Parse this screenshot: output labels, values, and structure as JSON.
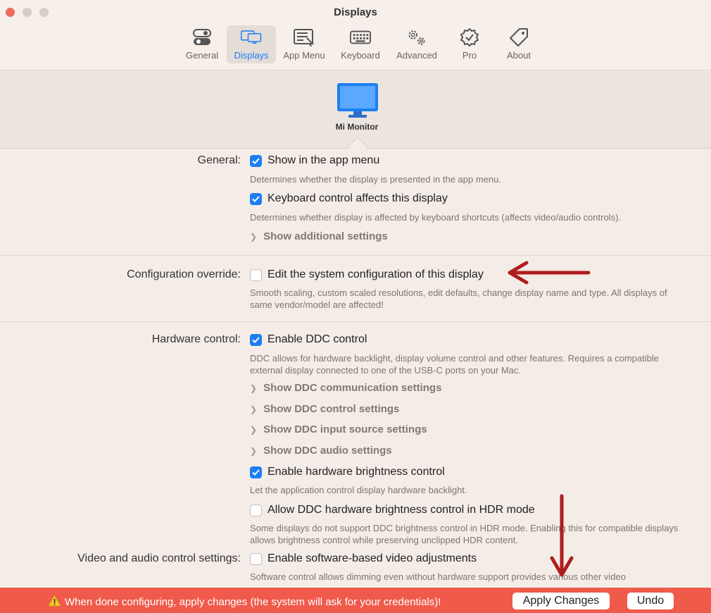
{
  "window": {
    "title": "Displays"
  },
  "tabs": [
    {
      "label": "General",
      "icon": "toggles-icon"
    },
    {
      "label": "Displays",
      "icon": "displays-icon"
    },
    {
      "label": "App Menu",
      "icon": "app-menu-icon"
    },
    {
      "label": "Keyboard",
      "icon": "keyboard-icon"
    },
    {
      "label": "Advanced",
      "icon": "gears-icon"
    },
    {
      "label": "Pro",
      "icon": "verified-badge-icon"
    },
    {
      "label": "About",
      "icon": "tag-icon"
    }
  ],
  "active_tab": "Displays",
  "display": {
    "name": "Mi Monitor"
  },
  "general": {
    "label": "General:",
    "show_in_menu": {
      "label": "Show in the app menu",
      "checked": true,
      "desc": "Determines whether the display is presented in the app menu."
    },
    "keyboard_control": {
      "label": "Keyboard control affects this display",
      "checked": true,
      "desc": "Determines whether display is affected by keyboard shortcuts (affects video/audio controls)."
    },
    "additional": "Show additional settings"
  },
  "config_override": {
    "label": "Configuration override:",
    "edit_config": {
      "label": "Edit the system configuration of this display",
      "checked": false,
      "desc": "Smooth scaling, custom scaled resolutions, edit defaults, change display name and type. All displays of same vendor/model are affected!"
    }
  },
  "hardware": {
    "label": "Hardware control:",
    "ddc": {
      "label": "Enable DDC control",
      "checked": true,
      "desc": "DDC allows for hardware backlight, display volume control and other features. Requires a compatible external display connected to one of the USB-C ports on your Mac."
    },
    "disclosures": [
      "Show DDC communication settings",
      "Show DDC control settings",
      "Show DDC input source settings",
      "Show DDC audio settings"
    ],
    "hw_brightness": {
      "label": "Enable hardware brightness control",
      "checked": true,
      "desc": "Let the application control display hardware backlight."
    },
    "hdr": {
      "label": "Allow DDC hardware brightness control in HDR mode",
      "checked": false,
      "desc": "Some displays do not support DDC brightness control in HDR mode. Enabling this for compatible displays allows brightness control while preserving unclipped HDR content."
    }
  },
  "video_audio": {
    "label": "Video and audio control settings:",
    "software": {
      "label": "Enable software-based video adjustments",
      "checked": false,
      "desc": "Software control allows dimming even without hardware support provides various other video"
    }
  },
  "banner": {
    "message": "When done configuring, apply changes (the system will ask for your credentials)!",
    "apply": "Apply Changes",
    "undo": "Undo",
    "color": "#ef5a4b"
  },
  "accent_color": "#1d7ef2",
  "annotation_color": "#b01c1c"
}
